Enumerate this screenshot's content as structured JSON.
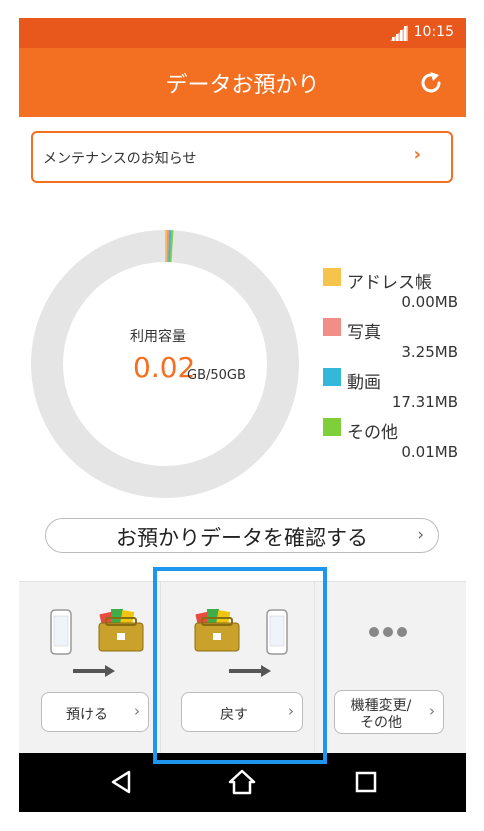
{
  "status_bar": {
    "time": "10:15"
  },
  "app_bar": {
    "title": "データお預かり"
  },
  "notice": {
    "label": "メンテナンスのお知らせ"
  },
  "usage": {
    "label": "利用容量",
    "value": "0.02",
    "unit": "GB/50GB"
  },
  "chart_data": {
    "type": "pie",
    "center_label": "利用容量",
    "slices": [
      {
        "name": "アドレス帳",
        "value": 0.0,
        "unit": "MB",
        "display": "0.00MB",
        "color": "#f6c34b"
      },
      {
        "name": "写真",
        "value": 3.25,
        "unit": "MB",
        "display": "3.25MB",
        "color": "#f28e87"
      },
      {
        "name": "動画",
        "value": 17.31,
        "unit": "MB",
        "display": "17.31MB",
        "color": "#33b8d9"
      },
      {
        "name": "その他",
        "value": 0.01,
        "unit": "MB",
        "display": "0.01MB",
        "color": "#7fcf3a"
      }
    ],
    "total_capacity_gb": 50,
    "empty_color": "#e5e5e5",
    "legend_position": "right"
  },
  "confirm_button": {
    "label": "お預かりデータを確認する"
  },
  "actions": {
    "deposit": {
      "label": "預ける"
    },
    "restore": {
      "label": "戻す"
    },
    "other": {
      "label_line1": "機種変更/",
      "label_line2": "その他"
    }
  },
  "colors": {
    "accent": "#f36f21",
    "status_bar": "#e8581c",
    "highlight": "#1e96f0"
  }
}
